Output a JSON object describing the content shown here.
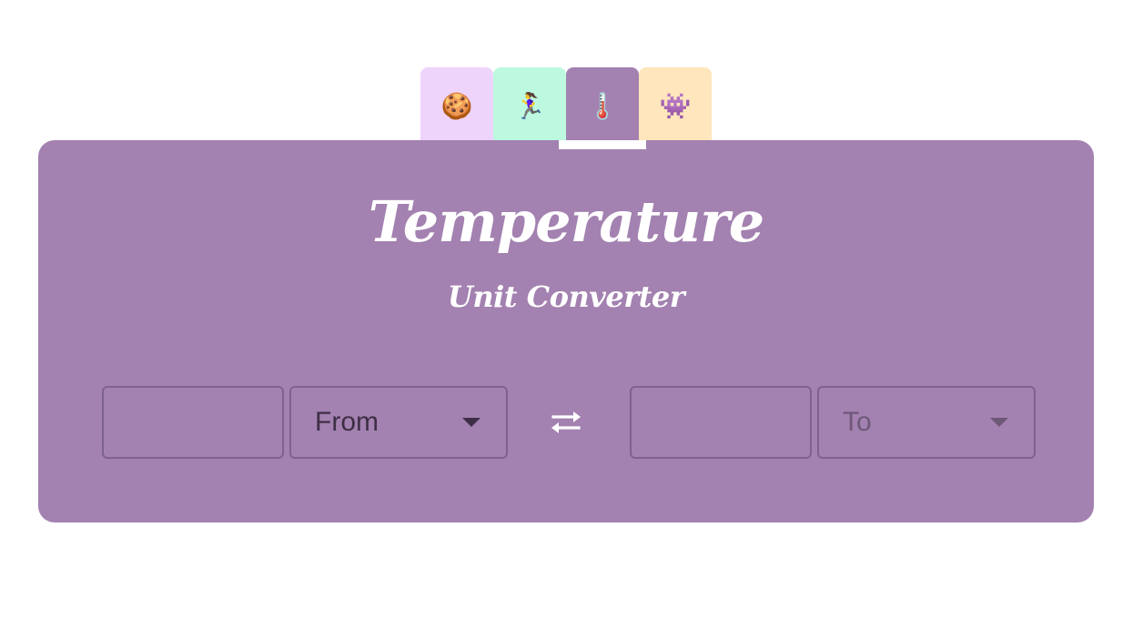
{
  "tabs": [
    {
      "name": "tab-cookie",
      "icon": "cookie-icon",
      "glyph": "🍪",
      "color": "#eed4fb"
    },
    {
      "name": "tab-running",
      "icon": "running-woman-icon",
      "glyph": "🏃‍♀️",
      "color": "#bcf9df"
    },
    {
      "name": "tab-temperature",
      "icon": "thermometer-icon",
      "glyph": "🌡️",
      "color": "#a381b0",
      "active": true
    },
    {
      "name": "tab-space-invader",
      "icon": "space-invader-icon",
      "glyph": "👾",
      "color": "#ffe6bc"
    }
  ],
  "card": {
    "color": "#a381b0",
    "title": "Temperature",
    "subtitle": "Unit Converter"
  },
  "converter": {
    "from_value": "",
    "from_select": "From",
    "to_value": "",
    "to_select": "To",
    "swap_icon": "swap-arrows-icon",
    "from_text_color": "#3e2f46",
    "to_text_color": "#6e5877"
  }
}
